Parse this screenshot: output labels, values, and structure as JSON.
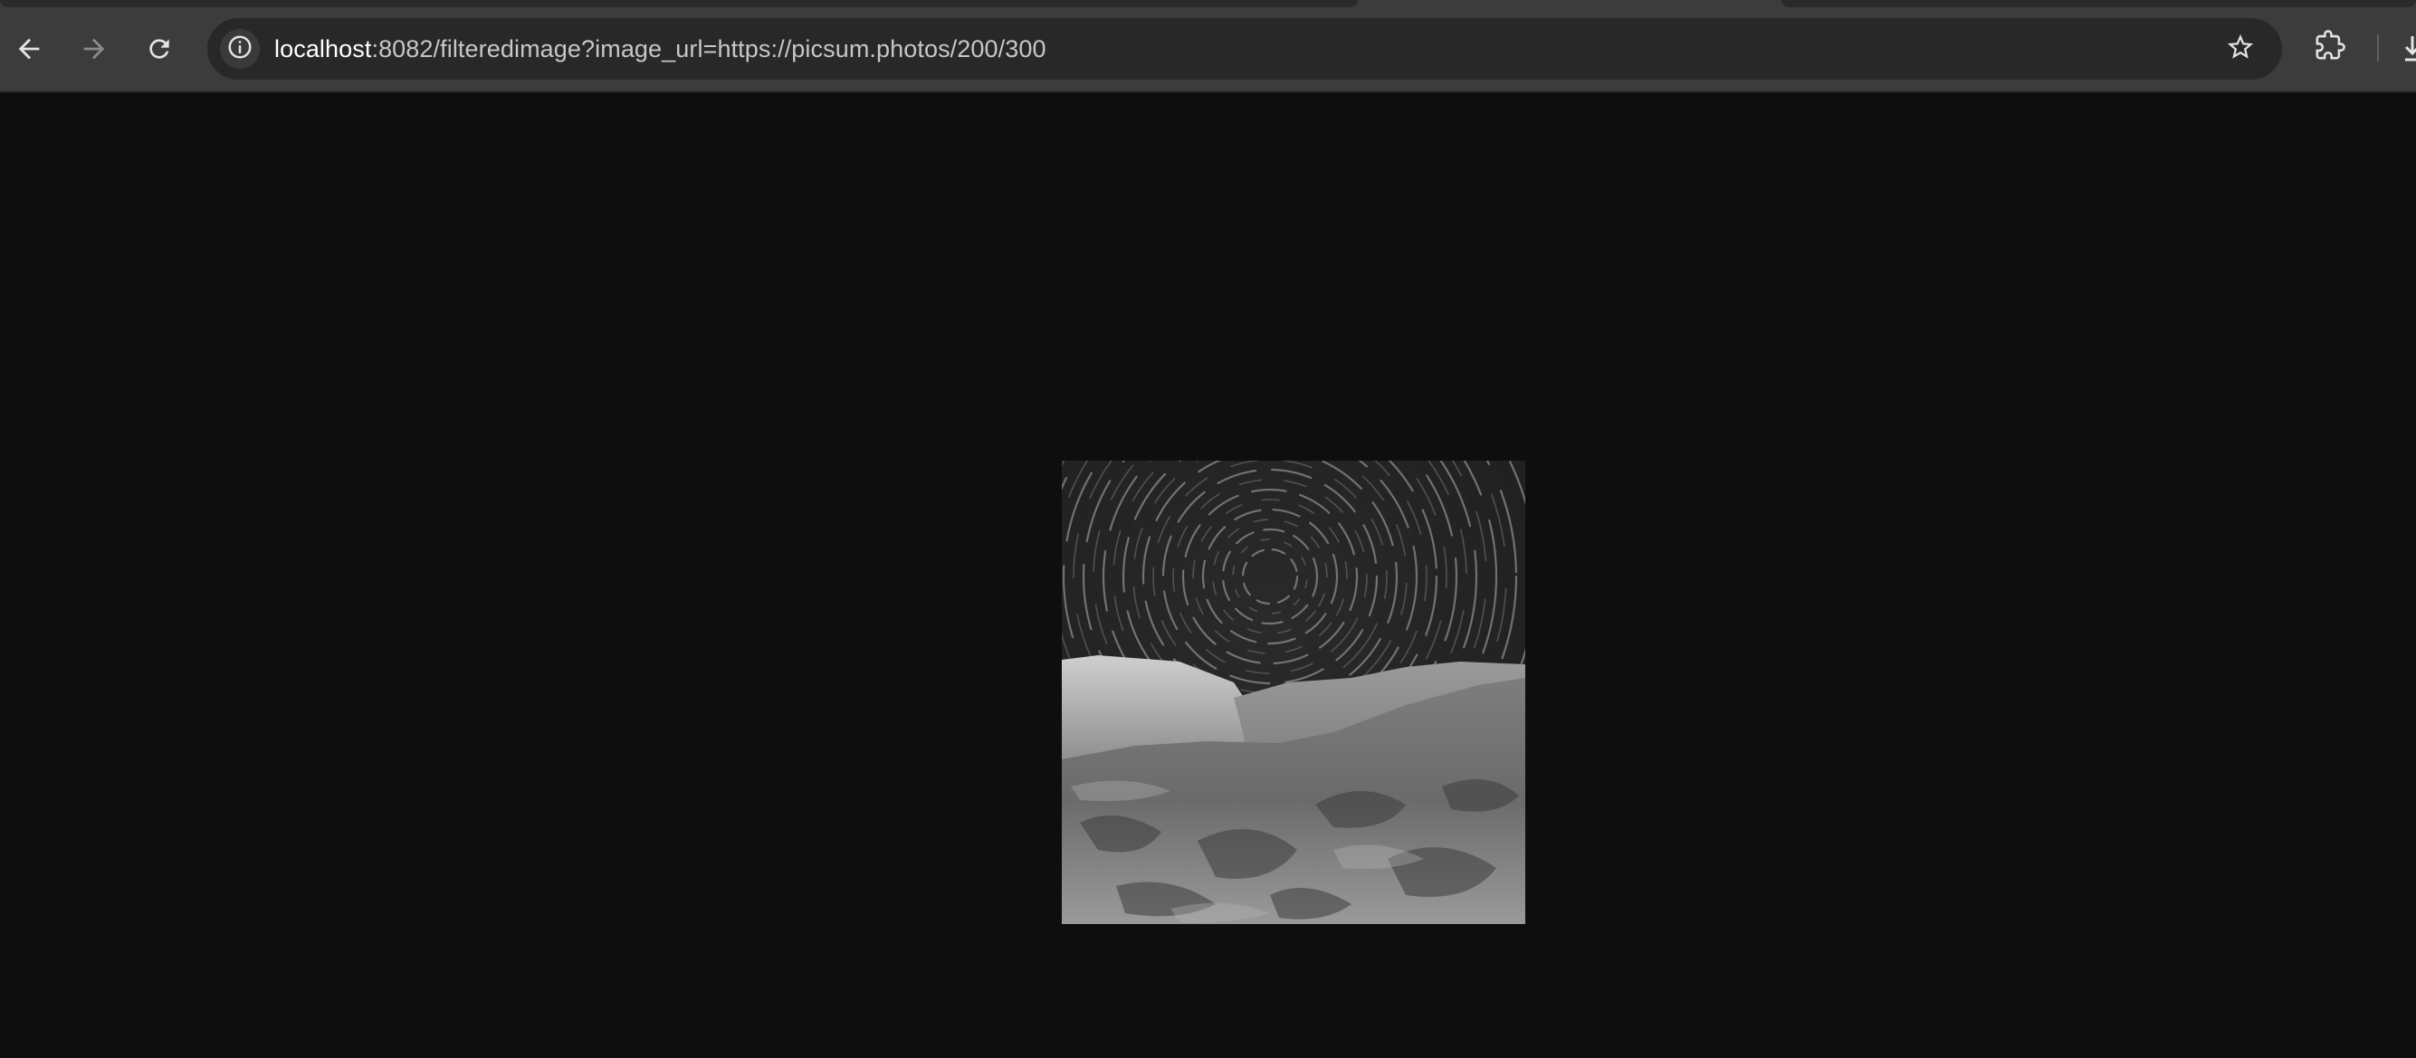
{
  "browser": {
    "nav": {
      "back_icon": "arrow-left-icon",
      "forward_icon": "arrow-right-icon",
      "reload_icon": "reload-icon"
    },
    "omnibox": {
      "site_info_icon": "info-icon",
      "url_host": "localhost",
      "url_rest": ":8082/filteredimage?image_url=https://picsum.photos/200/300",
      "bookmark_icon": "star-outline-icon"
    },
    "extensions_icon": "puzzle-piece-icon"
  },
  "page": {
    "background": "#0e0e0e",
    "image": {
      "description_icon": "grayscale-star-trails-photo",
      "filter": "grayscale"
    }
  },
  "colors": {
    "toolbar": "#3c3c3c",
    "omnibox": "#282828",
    "url_text": "#c7c7c7",
    "url_host_text": "#ffffff",
    "page_bg": "#0e0e0e"
  }
}
